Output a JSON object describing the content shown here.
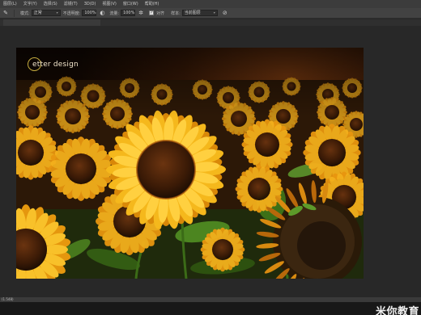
{
  "menubar": {
    "items": [
      "图层(L)",
      "文字(Y)",
      "选择(S)",
      "滤镜(T)",
      "3D(D)",
      "视图(V)",
      "窗口(W)",
      "帮助(H)"
    ]
  },
  "options": {
    "mode_value": "正常",
    "opacity_label": "不透明度:",
    "opacity_value": "100%",
    "flow_label": "流量:",
    "flow_value": "100%",
    "align_label": "对齐",
    "sample_label": "样本:",
    "sample_value": "当前图层"
  },
  "document": {
    "tab_title": ""
  },
  "canvas": {
    "overlay_text": "etter design"
  },
  "status": {
    "zoom_text": "(1.548)"
  },
  "watermark": {
    "text": "米你教育"
  },
  "icons": {
    "tool": "brush-icon",
    "airbrush": "airbrush-icon",
    "pressure": "pressure-icon",
    "sample": "sample-layers-icon"
  }
}
